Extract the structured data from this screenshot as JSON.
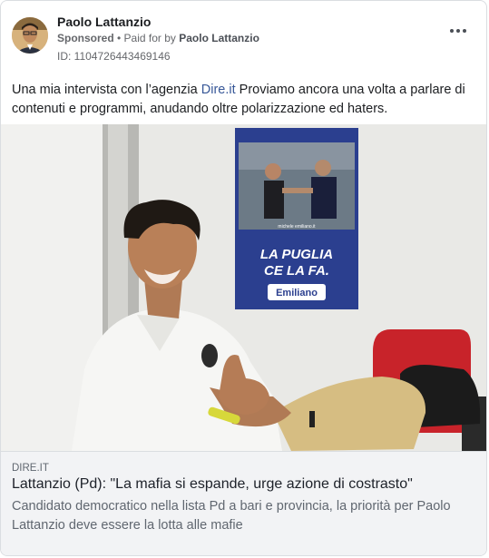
{
  "post": {
    "page_name": "Paolo Lattanzio",
    "sponsored": "Sponsored",
    "paid_for_prefix": " • Paid for by ",
    "paid_for_by": "Paolo Lattanzio",
    "ad_id": "ID: 1104726443469146",
    "more_icon": "more-horizontal-icon",
    "text_before_link": "Una mia intervista con l’agenzia ",
    "text_link": "Dire.it",
    "text_after_link": " Proviamo ancora una volta a parlare di contenuti e programmi, anudando oltre polarizzazione ed haters."
  },
  "photo": {
    "poster_headline_line1": "LA PUGLIA",
    "poster_headline_line2": "CE LA FA.",
    "poster_brand": "Emiliano",
    "poster_small_text": "michele emiliano.it"
  },
  "link_preview": {
    "domain": "DIRE.IT",
    "title": "Lattanzio (Pd): \"La mafia si espande, urge azione di costrasto\"",
    "description": "Candidato democratico nella lista Pd a bari e provincia, la priorità per Paolo Lattanzio deve essere la lotta alle mafie"
  },
  "colors": {
    "link": "#385898",
    "poster_blue": "#2b3f8f",
    "chair_red": "#c8232a"
  }
}
